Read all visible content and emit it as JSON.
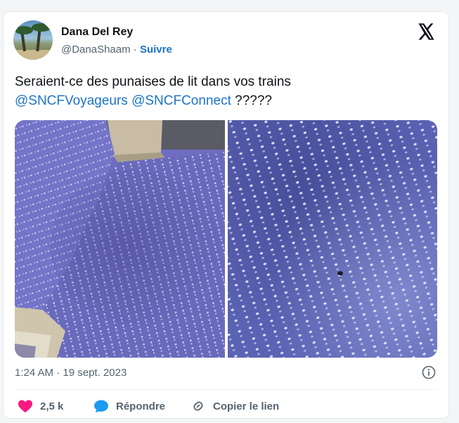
{
  "author": {
    "name": "Dana Del Rey",
    "handle": "@DanaShaam",
    "separator": "·",
    "follow_label": "Suivre"
  },
  "tweet": {
    "text_line1": "Seraient-ce des punaises de lit dans vos trains",
    "mention1": "@SNCFVoyageurs",
    "mention2": "@SNCFConnect",
    "suffix": " ?????"
  },
  "meta": {
    "time": "1:24 AM",
    "separator": "·",
    "date": "19 sept. 2023"
  },
  "actions": {
    "like_count": "2,5 k",
    "reply_label": "Répondre",
    "copy_link_label": "Copier le lien"
  },
  "colors": {
    "link": "#1d74c7",
    "like": "#f91880",
    "reply": "#1d9bf0",
    "seat_fabric": "#6f6fc4"
  },
  "icons": {
    "close": "x-logo-icon",
    "info": "info-icon",
    "like": "heart-icon",
    "reply": "speech-bubble-icon",
    "copy": "link-icon"
  }
}
